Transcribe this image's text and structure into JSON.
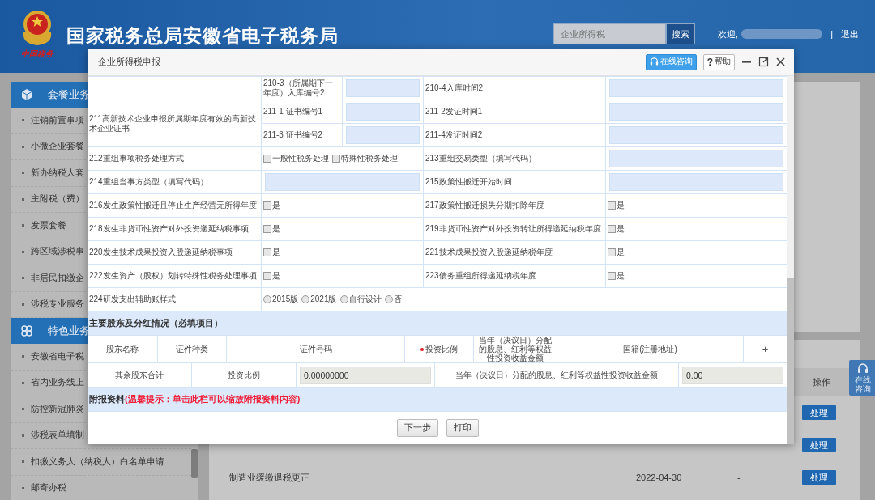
{
  "header": {
    "site_title": "国家税务总局安徽省电子税务局",
    "emblem_caption": "中国税务",
    "search": {
      "placeholder": "企业所得税",
      "button": "搜索"
    },
    "welcome": "欢迎,",
    "separator": "|",
    "logout": "退出"
  },
  "sidebar": {
    "sections": [
      {
        "title": "套餐业务",
        "items": [
          "注销前置事项",
          "小微企业套餐",
          "新办纳税人套",
          "主附税（费）",
          "发票套餐",
          "跨区域涉税事",
          "非居民扣缴企",
          "涉税专业服务"
        ]
      },
      {
        "title": "特色业务",
        "items": [
          "安徽省电子税",
          "省内业务线上",
          "防控新冠肺炎",
          "涉税表单填制",
          "扣缴义务人（纳税人）白名单申请",
          "邮寄办税"
        ]
      }
    ]
  },
  "main_table": {
    "operation_header": "操作",
    "rows": [
      {
        "action": "处理"
      },
      {
        "action": "处理"
      },
      {
        "name": "制造业缓缴退税更正",
        "date": "2022-04-30",
        "column_3": "-",
        "action": "处理"
      }
    ]
  },
  "float_widget": {
    "label": "在线咨询"
  },
  "dialog": {
    "title": "企业所得税申报",
    "consult_button": "在线咨询",
    "help_icon": "?",
    "help_button": "帮助",
    "form_rows": [
      {
        "kind": "group",
        "rows": [
          {
            "cells": [
              {
                "kind": "label",
                "text": "210-3（所属期下一年度）入库编号2"
              },
              {
                "kind": "field"
              },
              {
                "kind": "label",
                "text": "210-4入库时间2"
              },
              {
                "kind": "field"
              }
            ]
          }
        ]
      },
      {
        "kind": "group",
        "label": "211高新技术企业申报所属期年度有效的高新技术企业证书",
        "rows": [
          {
            "cells": [
              {
                "kind": "label",
                "text": "211-1 证书编号1"
              },
              {
                "kind": "field"
              },
              {
                "kind": "label",
                "text": "211-2发证时间1"
              },
              {
                "kind": "field"
              }
            ]
          },
          {
            "cells": [
              {
                "kind": "label",
                "text": "211-3 证书编号2"
              },
              {
                "kind": "field"
              },
              {
                "kind": "label",
                "text": "211-4发证时间2"
              },
              {
                "kind": "field"
              }
            ]
          }
        ]
      },
      {
        "kind": "row",
        "cells": [
          {
            "kind": "label",
            "text": "212重组事项税务处理方式"
          },
          {
            "kind": "checks",
            "options": [
              {
                "label": "一般性税务处理",
                "checked": false
              },
              {
                "label": "特殊性税务处理",
                "checked": false
              }
            ]
          },
          {
            "kind": "label",
            "text": "213重组交易类型（填写代码）"
          },
          {
            "kind": "field"
          }
        ]
      },
      {
        "kind": "row",
        "cells": [
          {
            "kind": "label",
            "text": "214重组当事方类型（填写代码）"
          },
          {
            "kind": "field"
          },
          {
            "kind": "label",
            "text": "215政策性搬迁开始时间"
          },
          {
            "kind": "field"
          }
        ]
      },
      {
        "kind": "row",
        "cells": [
          {
            "kind": "label",
            "text": "216发生政策性搬迁且停止生产经营无所得年度"
          },
          {
            "kind": "checks",
            "options": [
              {
                "label": "是",
                "checked": false
              }
            ]
          },
          {
            "kind": "label",
            "text": "217政策性搬迁损失分期扣除年度"
          },
          {
            "kind": "checks",
            "options": [
              {
                "label": "是",
                "checked": false
              }
            ]
          }
        ]
      },
      {
        "kind": "row",
        "cells": [
          {
            "kind": "label",
            "text": "218发生非货币性资产对外投资递延纳税事项"
          },
          {
            "kind": "checks",
            "options": [
              {
                "label": "是",
                "checked": false
              }
            ]
          },
          {
            "kind": "label",
            "text": "219非货币性资产对外投资转让所得递延纳税年度"
          },
          {
            "kind": "checks",
            "options": [
              {
                "label": "是",
                "checked": false
              }
            ]
          }
        ]
      },
      {
        "kind": "row",
        "cells": [
          {
            "kind": "label",
            "text": "220发生技术成果投资入股递延纳税事项"
          },
          {
            "kind": "checks",
            "options": [
              {
                "label": "是",
                "checked": false
              }
            ]
          },
          {
            "kind": "label",
            "text": "221技术成果投资入股递延纳税年度"
          },
          {
            "kind": "checks",
            "options": [
              {
                "label": "是",
                "checked": false
              }
            ]
          }
        ]
      },
      {
        "kind": "row",
        "cells": [
          {
            "kind": "label",
            "text": "222发生资产（股权）划转特殊性税务处理事项"
          },
          {
            "kind": "checks",
            "options": [
              {
                "label": "是",
                "checked": false
              }
            ]
          },
          {
            "kind": "label",
            "text": "223债务重组所得递延纳税年度"
          },
          {
            "kind": "checks",
            "options": [
              {
                "label": "是",
                "checked": false
              }
            ]
          }
        ]
      },
      {
        "kind": "row",
        "cells": [
          {
            "kind": "label",
            "text": "224研发支出辅助账样式"
          },
          {
            "kind": "radios",
            "options": [
              {
                "label": "2015版",
                "selected": false
              },
              {
                "label": "2021版",
                "selected": false
              },
              {
                "label": "自行设计",
                "selected": false
              },
              {
                "label": "否",
                "selected": false
              }
            ]
          }
        ]
      }
    ],
    "shareholder_section": {
      "title": "主要股东及分红情况（必填项目）",
      "columns": [
        {
          "label": "股东名称",
          "required": false
        },
        {
          "label": "证件种类",
          "required": false
        },
        {
          "label": "证件号码",
          "required": false
        },
        {
          "label": "投资比例",
          "required": true
        },
        {
          "label": "当年（决议日）分配的股息、红利等权益性投资收益金额",
          "required": false
        },
        {
          "label": "国籍(注册地址)",
          "required": false
        }
      ],
      "add_button": "+",
      "summary": {
        "label": "其余股东合计",
        "ratio_label": "投资比例",
        "ratio_value": "0.00000000",
        "dividend_label": "当年（决议日）分配的股息、红利等权益性投资收益金额",
        "dividend_value": "0.00"
      }
    },
    "attachments": {
      "title": "附报资料",
      "hint": "(温馨提示：单击此栏可以缩放附报资料内容)"
    },
    "buttons": [
      "下一步",
      "打印"
    ]
  }
}
